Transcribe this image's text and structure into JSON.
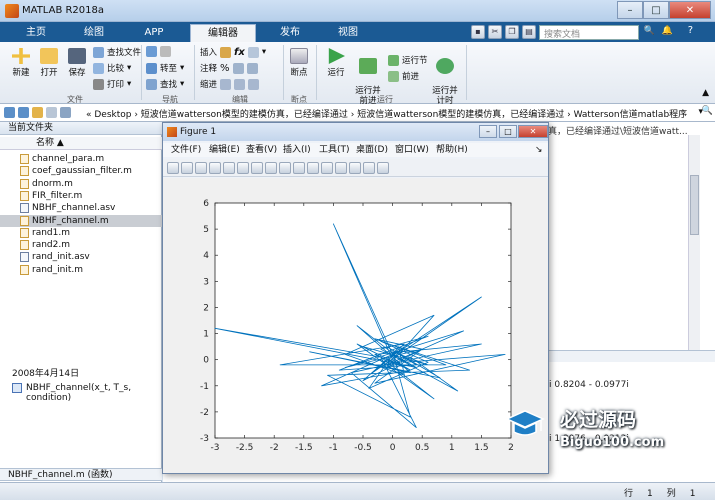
{
  "app": {
    "title": "MATLAB R2018a"
  },
  "tabs": [
    "主页",
    "绘图",
    "APP",
    "编辑器",
    "发布",
    "视图"
  ],
  "search": {
    "placeholder": "搜索文档"
  },
  "ribbon": {
    "file": {
      "new": "新建",
      "open": "打开",
      "save": "保存",
      "find_files": "查找文件",
      "compare": "比较",
      "print": "打印",
      "group": "文件"
    },
    "nav": {
      "goto": "转至",
      "find": "查找",
      "group": "导航"
    },
    "edit": {
      "insert": "插入",
      "comment": "注释",
      "indent": "缩进",
      "fx": "fx",
      "group": "编辑"
    },
    "breakpoint": {
      "label": "断点",
      "group": "断点"
    },
    "run": {
      "run": "运行",
      "run_advance": "运行并\n前进",
      "run_section": "运行节",
      "advance": "前进",
      "run_time": "运行并\n计时",
      "group": "运行"
    }
  },
  "address": {
    "path": "« Desktop › 短波信道watterson模型的建模仿真，已经编译通过 › 短波信道watterson模型的建模仿真，已经编译通过 › Watterson信道matlab程序",
    "right_path": "真，已经编译通过\\短波信道watt..."
  },
  "current_folder": {
    "title": "当前文件夹",
    "col_name": "名称 ▲",
    "files": [
      {
        "name": "channel_para.m",
        "type": "m"
      },
      {
        "name": "coef_gaussian_filter.m",
        "type": "m"
      },
      {
        "name": "dnorm.m",
        "type": "m"
      },
      {
        "name": "FIR_filter.m",
        "type": "m"
      },
      {
        "name": "NBHF_channel.asv",
        "type": "asv"
      },
      {
        "name": "NBHF_channel.m",
        "type": "m",
        "selected": true
      },
      {
        "name": "rand1.m",
        "type": "m"
      },
      {
        "name": "rand2.m",
        "type": "m"
      },
      {
        "name": "rand_init.asv",
        "type": "asv"
      },
      {
        "name": "rand_init.m",
        "type": "m"
      }
    ],
    "detail_title": "NBHF_channel.m (函数)",
    "date": "2008年4月14日",
    "signature": "NBHF_channel(x_t, T_s, condition)"
  },
  "console": {
    "v1": "i   0.8204 - 0.0977i",
    "v2": "i   1.3076 - 0.0212i"
  },
  "status": {
    "row_label": "行",
    "row": "1",
    "col_label": "列",
    "col": "1"
  },
  "figure": {
    "title": "Figure 1",
    "menu": [
      "文件(F)",
      "编辑(E)",
      "查看(V)",
      "插入(I)",
      "工具(T)",
      "桌面(D)",
      "窗口(W)",
      "帮助(H)"
    ]
  },
  "chart_data": {
    "type": "line",
    "title": "",
    "xlabel": "",
    "ylabel": "",
    "xlim": [
      -3,
      2
    ],
    "ylim": [
      -3,
      6
    ],
    "xticks": [
      -3,
      -2.5,
      -2,
      -1.5,
      -1,
      -0.5,
      0,
      0.5,
      1,
      1.5,
      2
    ],
    "yticks": [
      -3,
      -2,
      -1,
      0,
      1,
      2,
      3,
      4,
      5,
      6
    ],
    "x": [
      0,
      -1.0,
      0,
      0.4,
      -3.0,
      -0.2,
      0.7,
      -0.6,
      0.3,
      -1.2,
      0.1,
      1.5,
      -0.4,
      0.2,
      -0.1,
      1.2,
      -0.8,
      0.5,
      -0.3,
      0.9,
      -1.9,
      0.2,
      -0.5,
      0.3,
      1.1,
      -0.2,
      0.6,
      -0.9,
      0.4,
      -0.1,
      0.8,
      -1.4,
      0.3,
      -0.6,
      0.2,
      1.9,
      -0.3,
      0.5,
      -0.1,
      0.7,
      -0.8,
      0.2,
      0.1,
      -0.4,
      0.6,
      -0.2,
      1.3,
      -1.1,
      0.3,
      0.0,
      0.6,
      -0.5,
      0.2,
      -0.3,
      1.5,
      -0.7,
      0.4,
      -0.2,
      0.3,
      0.0
    ],
    "y": [
      0,
      5.2,
      0.2,
      -0.3,
      1.2,
      0.1,
      -1.5,
      0.6,
      -0.4,
      -1.0,
      0.3,
      2.4,
      -0.6,
      0.5,
      -0.2,
      1.1,
      -0.3,
      0.4,
      0.8,
      -0.2,
      -0.2,
      0.6,
      -0.8,
      0.1,
      -1.2,
      0.4,
      0.9,
      -0.4,
      -0.2,
      0.5,
      -0.7,
      0.3,
      -0.5,
      1.3,
      -0.1,
      0.2,
      -0.9,
      0.4,
      -0.3,
      1.7,
      0.2,
      -0.6,
      0.5,
      -1.1,
      -0.1,
      0.7,
      -0.4,
      -0.6,
      -2.2,
      0.3,
      -0.2,
      0.5,
      -0.3,
      0.2,
      0.6,
      -0.5,
      -2.6,
      0.1,
      -0.4,
      0
    ]
  }
}
